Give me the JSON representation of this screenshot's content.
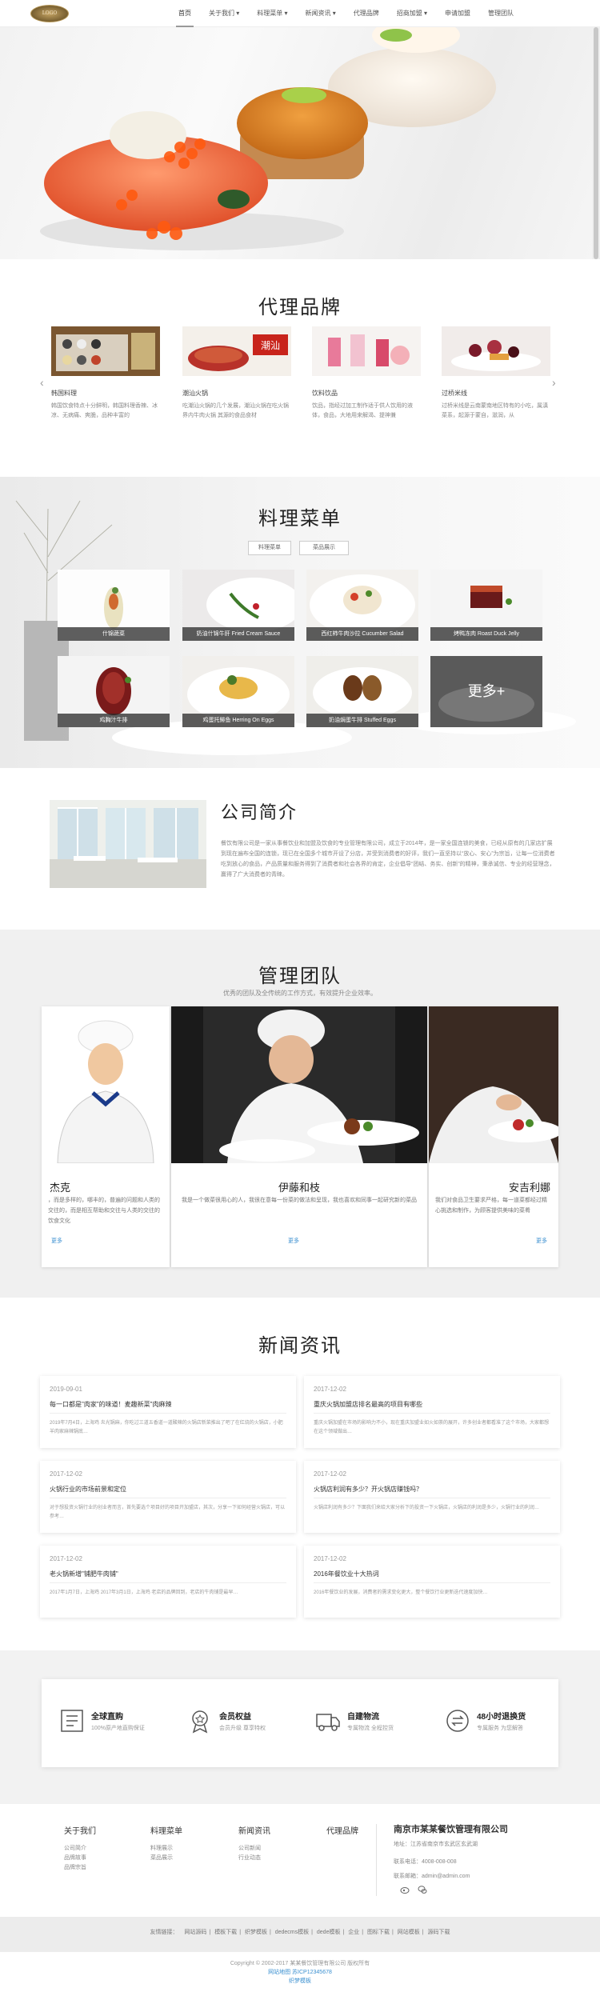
{
  "logo": {
    "text": "LOGO"
  },
  "nav": {
    "items": [
      {
        "label": "首页",
        "active": true
      },
      {
        "label": "关于我们 ▾"
      },
      {
        "label": "料理菜单 ▾"
      },
      {
        "label": "新闻资讯 ▾"
      },
      {
        "label": "代理品牌"
      },
      {
        "label": "招商加盟 ▾"
      },
      {
        "label": "申请加盟"
      },
      {
        "label": "管理团队"
      }
    ]
  },
  "brands": {
    "title": "代理品牌",
    "items": [
      {
        "name": "韩国料理",
        "desc": "韩国饮食特点十分鲜明，韩国料理香辣、冰凉、无病痛、爽脆，品种丰富的"
      },
      {
        "name": "潮汕火锅",
        "desc": "吃潮汕火锅的几个发展，潮汕火锅在吃火锅界内牛肉火锅 其源的食品食材"
      },
      {
        "name": "饮料饮品",
        "desc": "饮品，指经过加工制作适于供人饮用的液体，食品，大地用来解渴、提神兼"
      },
      {
        "name": "过桥米线",
        "desc": "过桥米线是云南蒙南地区特有的小吃，属滇菜系，起源于蒙自，滋润，从"
      }
    ],
    "prev_icon": "chevron-left-icon",
    "next_icon": "chevron-right-icon"
  },
  "menu": {
    "title": "料理菜单",
    "tabs": [
      "料理菜单",
      "菜品展示"
    ],
    "dishes": [
      {
        "caption": "什锦蔬菜"
      },
      {
        "caption": "奶油什锦牛肝 Fried Cream Sauce"
      },
      {
        "caption": "西红柿牛肉沙拉 Cucumber Salad"
      },
      {
        "caption": "烤鸭冻肉 Roast Duck Jelly"
      },
      {
        "caption": "鸡胸汁牛排"
      },
      {
        "caption": "鸡蛋托鲱鱼 Herring On Eggs"
      },
      {
        "caption": "奶油焗蛋牛排 Stuffed Eggs"
      }
    ],
    "more_label": "更多+"
  },
  "intro": {
    "title": "公司简介",
    "text": "餐饮有限公司是一家从事餐饮业和加盟及饮食的专业管理有限公司，成立于2014年，是一家全国连锁的美食，已经从原有的几家店扩展到现在遍布全国的连锁，现已在全国多个城市开设了分店，并受到消费者的好评，我们一直坚持以“放心、安心”为宗旨，让每一位消费者吃到放心的食品，产品质量和服务得到了消费者和社会各界的肯定，企业倡导“团结、务实、创新”的精神，秉承诚信、专业的经营理念，赢得了广大消费者的青睐。"
  },
  "team": {
    "title": "管理团队",
    "subtitle": "优秀的团队及全传统的工作方式，有效提升企业效率。",
    "members": [
      {
        "name": "杰克",
        "desc": "，而是多样的，哪丰的，普遍的问题和人类的交往的，而是相互帮助和交往与人类的交往的饮食文化",
        "more": "更多"
      },
      {
        "name": "伊藤和枝",
        "desc": "我是一个做菜很用心的人，我很在意每一份菜的做法和呈现，我也喜欢和同事一起研究新的菜品",
        "more": "更多"
      },
      {
        "name": "安吉利娜",
        "desc": "我们对食品卫生要求严格，每一道菜都经过精心挑选和制作，为顾客提供美味的菜肴",
        "more": "更多"
      }
    ]
  },
  "news": {
    "title": "新闻资讯",
    "items": [
      {
        "date": "2019-09-01",
        "title": "每一口都是\"肉家\"的味道！麦趣新菜\"肉麻辣",
        "desc": "2019年7月4日，上海鸡 炎光锅麻，你吃过三道五香道一道酸辣的火锅店新菜推出了吧了在红烧的火锅店，小肥羊肉家麻辣锅底…"
      },
      {
        "date": "2017-12-02",
        "title": "重庆火锅加盟店排名最高的项目有哪些",
        "desc": "重庆火锅加盟在市场的影响力不小，现在重庆加盟业如火如荼的展开，许多创业者都看准了这个市场，大家都想在这个领域做出…"
      },
      {
        "date": "2017-12-02",
        "title": "火锅行业的市场前景和定位",
        "desc": "对于想投资火锅行业的创业者而言，首先要选个项目好的项目开加盟店，其次，分享一下如何经营火锅店，可以参考…"
      },
      {
        "date": "2017-12-02",
        "title": "火锅店利润有多少？开火锅店赚钱吗？",
        "desc": "火锅店利润有多少？下面我们来给大家分析下的投资一下火锅店，火锅店的利润是多少，火锅行业的利润…"
      },
      {
        "date": "2017-12-02",
        "title": "老火锅新增\"铺肥牛肉铺\"",
        "desc": "2017年1月7日，上海鸡 2017年3月1日，上海鸡 老店的品牌回到，老店的牛肉铺是最早…"
      },
      {
        "date": "2017-12-02",
        "title": "2016年餐饮业十大热词",
        "desc": "2016年餐饮业的发展，消费者的需求变化更大，整个餐饮行业更新迭代速度加快…"
      }
    ]
  },
  "features": [
    {
      "icon": "search-globe-icon",
      "title": "全球直购",
      "sub": "100%原产地直购保证"
    },
    {
      "icon": "medal-icon",
      "title": "会员权益",
      "sub": "会员升级 尊享特权"
    },
    {
      "icon": "truck-icon",
      "title": "自建物流",
      "sub": "专属物流 全程控货"
    },
    {
      "icon": "exchange-icon",
      "title": "48小时退换货",
      "sub": "专属服务 为您解答"
    }
  ],
  "footer": {
    "cols": [
      {
        "head": "关于我们",
        "links": [
          "公司简介",
          "品牌故事",
          "品牌宗旨"
        ]
      },
      {
        "head": "料理菜单",
        "links": [
          "料理展示",
          "菜品展示"
        ]
      },
      {
        "head": "新闻资讯",
        "links": [
          "公司新闻",
          "行业动态"
        ]
      },
      {
        "head": "代理品牌",
        "links": []
      }
    ],
    "company": "南京市某某餐饮管理有限公司",
    "address": "地址：江苏省南京市玄武区玄武湖",
    "phone": "联系电话：4008-008-008",
    "email": "联系邮箱：admin@admin.com",
    "social_icons": [
      "weibo-icon",
      "wechat-icon"
    ],
    "friend_links": [
      "友情链接：",
      "网站源码",
      "模板下载",
      "织梦模板",
      "dedecms模板",
      "dede模板",
      "企业",
      "图标下载",
      "网站模板",
      "源码下载"
    ],
    "copyright": "Copyright © 2002-2017 某某餐饮管理有限公司 版权所有",
    "icp": "网站地图  苏ICP12345678",
    "credit": "织梦模板"
  }
}
